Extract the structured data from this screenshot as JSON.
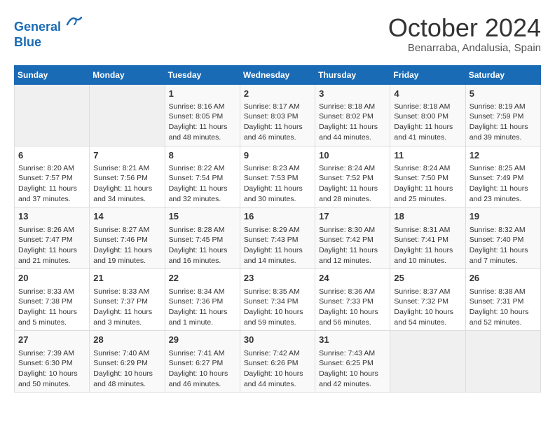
{
  "logo": {
    "line1": "General",
    "line2": "Blue"
  },
  "title": "October 2024",
  "location": "Benarraba, Andalusia, Spain",
  "days_of_week": [
    "Sunday",
    "Monday",
    "Tuesday",
    "Wednesday",
    "Thursday",
    "Friday",
    "Saturday"
  ],
  "weeks": [
    [
      {
        "day": "",
        "info": ""
      },
      {
        "day": "",
        "info": ""
      },
      {
        "day": "1",
        "info": "Sunrise: 8:16 AM\nSunset: 8:05 PM\nDaylight: 11 hours and 48 minutes."
      },
      {
        "day": "2",
        "info": "Sunrise: 8:17 AM\nSunset: 8:03 PM\nDaylight: 11 hours and 46 minutes."
      },
      {
        "day": "3",
        "info": "Sunrise: 8:18 AM\nSunset: 8:02 PM\nDaylight: 11 hours and 44 minutes."
      },
      {
        "day": "4",
        "info": "Sunrise: 8:18 AM\nSunset: 8:00 PM\nDaylight: 11 hours and 41 minutes."
      },
      {
        "day": "5",
        "info": "Sunrise: 8:19 AM\nSunset: 7:59 PM\nDaylight: 11 hours and 39 minutes."
      }
    ],
    [
      {
        "day": "6",
        "info": "Sunrise: 8:20 AM\nSunset: 7:57 PM\nDaylight: 11 hours and 37 minutes."
      },
      {
        "day": "7",
        "info": "Sunrise: 8:21 AM\nSunset: 7:56 PM\nDaylight: 11 hours and 34 minutes."
      },
      {
        "day": "8",
        "info": "Sunrise: 8:22 AM\nSunset: 7:54 PM\nDaylight: 11 hours and 32 minutes."
      },
      {
        "day": "9",
        "info": "Sunrise: 8:23 AM\nSunset: 7:53 PM\nDaylight: 11 hours and 30 minutes."
      },
      {
        "day": "10",
        "info": "Sunrise: 8:24 AM\nSunset: 7:52 PM\nDaylight: 11 hours and 28 minutes."
      },
      {
        "day": "11",
        "info": "Sunrise: 8:24 AM\nSunset: 7:50 PM\nDaylight: 11 hours and 25 minutes."
      },
      {
        "day": "12",
        "info": "Sunrise: 8:25 AM\nSunset: 7:49 PM\nDaylight: 11 hours and 23 minutes."
      }
    ],
    [
      {
        "day": "13",
        "info": "Sunrise: 8:26 AM\nSunset: 7:47 PM\nDaylight: 11 hours and 21 minutes."
      },
      {
        "day": "14",
        "info": "Sunrise: 8:27 AM\nSunset: 7:46 PM\nDaylight: 11 hours and 19 minutes."
      },
      {
        "day": "15",
        "info": "Sunrise: 8:28 AM\nSunset: 7:45 PM\nDaylight: 11 hours and 16 minutes."
      },
      {
        "day": "16",
        "info": "Sunrise: 8:29 AM\nSunset: 7:43 PM\nDaylight: 11 hours and 14 minutes."
      },
      {
        "day": "17",
        "info": "Sunrise: 8:30 AM\nSunset: 7:42 PM\nDaylight: 11 hours and 12 minutes."
      },
      {
        "day": "18",
        "info": "Sunrise: 8:31 AM\nSunset: 7:41 PM\nDaylight: 11 hours and 10 minutes."
      },
      {
        "day": "19",
        "info": "Sunrise: 8:32 AM\nSunset: 7:40 PM\nDaylight: 11 hours and 7 minutes."
      }
    ],
    [
      {
        "day": "20",
        "info": "Sunrise: 8:33 AM\nSunset: 7:38 PM\nDaylight: 11 hours and 5 minutes."
      },
      {
        "day": "21",
        "info": "Sunrise: 8:33 AM\nSunset: 7:37 PM\nDaylight: 11 hours and 3 minutes."
      },
      {
        "day": "22",
        "info": "Sunrise: 8:34 AM\nSunset: 7:36 PM\nDaylight: 11 hours and 1 minute."
      },
      {
        "day": "23",
        "info": "Sunrise: 8:35 AM\nSunset: 7:34 PM\nDaylight: 10 hours and 59 minutes."
      },
      {
        "day": "24",
        "info": "Sunrise: 8:36 AM\nSunset: 7:33 PM\nDaylight: 10 hours and 56 minutes."
      },
      {
        "day": "25",
        "info": "Sunrise: 8:37 AM\nSunset: 7:32 PM\nDaylight: 10 hours and 54 minutes."
      },
      {
        "day": "26",
        "info": "Sunrise: 8:38 AM\nSunset: 7:31 PM\nDaylight: 10 hours and 52 minutes."
      }
    ],
    [
      {
        "day": "27",
        "info": "Sunrise: 7:39 AM\nSunset: 6:30 PM\nDaylight: 10 hours and 50 minutes."
      },
      {
        "day": "28",
        "info": "Sunrise: 7:40 AM\nSunset: 6:29 PM\nDaylight: 10 hours and 48 minutes."
      },
      {
        "day": "29",
        "info": "Sunrise: 7:41 AM\nSunset: 6:27 PM\nDaylight: 10 hours and 46 minutes."
      },
      {
        "day": "30",
        "info": "Sunrise: 7:42 AM\nSunset: 6:26 PM\nDaylight: 10 hours and 44 minutes."
      },
      {
        "day": "31",
        "info": "Sunrise: 7:43 AM\nSunset: 6:25 PM\nDaylight: 10 hours and 42 minutes."
      },
      {
        "day": "",
        "info": ""
      },
      {
        "day": "",
        "info": ""
      }
    ]
  ]
}
